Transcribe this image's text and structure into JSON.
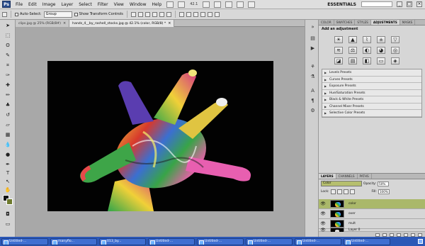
{
  "app": {
    "logo": "Ps",
    "workspace": "ESSENTIALS",
    "zoom": "42.1"
  },
  "menu": [
    "File",
    "Edit",
    "Image",
    "Layer",
    "Select",
    "Filter",
    "View",
    "Window",
    "Help"
  ],
  "options": {
    "auto_select": "Auto-Select:",
    "group_value": "Group",
    "show_transform": "Show Transform Controls"
  },
  "tabs": [
    {
      "label": "clips.jpg @ 25% (RGB/8#)",
      "active": false
    },
    {
      "label": "hands_4__by_rashell_stocks.jpg @ 42.1% (color, RGB/8) *",
      "active": true
    }
  ],
  "panel_tabs_top": [
    "COLOR",
    "SWATCHES",
    "STYLES",
    "ADJUSTMENTS",
    "MASKS"
  ],
  "adjustments": {
    "title": "Add an adjustment",
    "icons": [
      "brightness-icon",
      "levels-icon",
      "curves-icon",
      "exposure-icon",
      "vibrance-icon",
      "hue-sat-icon",
      "color-balance-icon",
      "bw-icon",
      "photo-filter-icon",
      "channel-mixer-icon",
      "invert-icon",
      "posterize-icon",
      "threshold-icon",
      "gradient-map-icon",
      "selective-color-icon"
    ],
    "glyphs": [
      "☀",
      "▲",
      "⌇",
      "±",
      "▽",
      "≋",
      "⚖",
      "◐",
      "◕",
      "◎",
      "◪",
      "▤",
      "◧",
      "▭",
      "◈"
    ],
    "presets": [
      "Levels Presets",
      "Curves Presets",
      "Exposure Presets",
      "Hue/Saturation Presets",
      "Black & White Presets",
      "Channel Mixer Presets",
      "Selective Color Presets"
    ]
  },
  "layers_panel": {
    "tabs": [
      "LAYERS",
      "CHANNELS",
      "PATHS"
    ],
    "opacity_label": "Opacity:",
    "opacity": "50%",
    "lock_label": "Lock:",
    "fill_label": "Fill:",
    "fill": "100%",
    "blend_mode": "Color",
    "layers": [
      {
        "name": "color",
        "selected": true
      },
      {
        "name": "over",
        "selected": false
      },
      {
        "name": "mult",
        "selected": false
      },
      {
        "name": "Layer 0",
        "selected": false
      }
    ]
  },
  "taskbar": [
    "Untitled-...",
    "manyflo...",
    "013_by...",
    "Untitled-...",
    "Untitled-...",
    "Untitled-...",
    "Untitled-...",
    "Untitled-..."
  ],
  "colors": {
    "foreground": "#111111",
    "background": "#6e7a2e",
    "selected_layer": "#aab86a",
    "taskbar": "#2b58b7"
  }
}
